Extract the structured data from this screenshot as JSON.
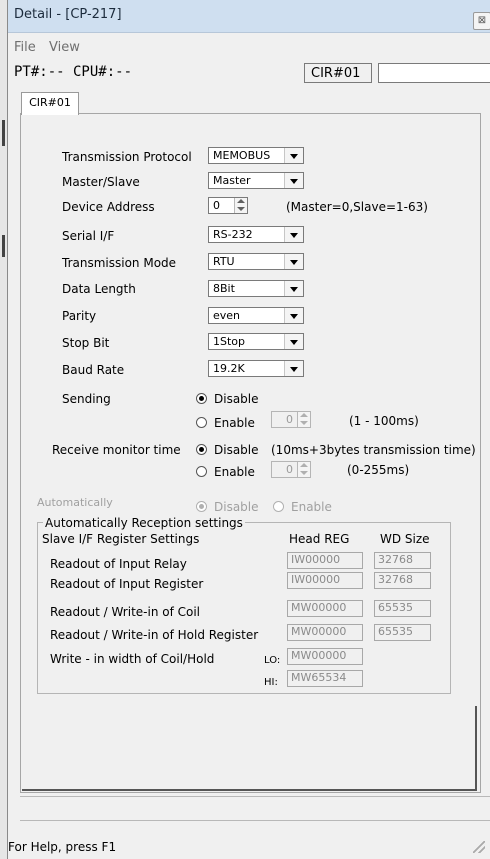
{
  "window": {
    "title": "Detail - [CP-217]",
    "close_glyph": "⊠"
  },
  "menu": {
    "file": "File",
    "view": "View"
  },
  "status_row": {
    "pt_cpu": "PT#:-- CPU#:--",
    "cir": "CIR#01",
    "empty": ""
  },
  "tab": {
    "label": "CIR#01"
  },
  "form": {
    "protocol": {
      "label": "Transmission Protocol",
      "value": "MEMOBUS"
    },
    "master_slave": {
      "label": "Master/Slave",
      "value": "Master"
    },
    "device_address": {
      "label": "Device Address",
      "value": "0",
      "hint": "(Master=0,Slave=1-63)"
    },
    "serial_if": {
      "label": "Serial I/F",
      "value": "RS-232"
    },
    "mode": {
      "label": "Transmission Mode",
      "value": "RTU"
    },
    "data_length": {
      "label": "Data Length",
      "value": "8Bit"
    },
    "parity": {
      "label": "Parity",
      "value": "even"
    },
    "stop_bit": {
      "label": "Stop Bit",
      "value": "1Stop"
    },
    "baud_rate": {
      "label": "Baud Rate",
      "value": "19.2K"
    },
    "sending": {
      "label": "Sending",
      "disable": "Disable",
      "enable": "Enable",
      "value": "0",
      "range": "(1 - 100ms)"
    },
    "receive": {
      "label": "Receive monitor time",
      "disable": "Disable",
      "enable": "Enable",
      "hint": "(10ms+3bytes transmission time)",
      "value": "0",
      "range": "(0-255ms)"
    },
    "auto": {
      "label": "Automatically",
      "disable": "Disable",
      "enable": "Enable"
    }
  },
  "reception": {
    "group_title": "Automatically Reception settings",
    "header_left": "Slave I/F Register Settings",
    "header_head": "Head REG",
    "header_size": "WD Size",
    "rows": [
      {
        "label": "Readout of Input Relay",
        "head": "IW00000",
        "size": "32768"
      },
      {
        "label": "Readout of Input Register",
        "head": "IW00000",
        "size": "32768"
      },
      {
        "label": "Readout / Write-in of Coil",
        "head": "MW00000",
        "size": "65535"
      },
      {
        "label": "Readout / Write-in of Hold Register",
        "head": "MW00000",
        "size": "65535"
      }
    ],
    "width_label": "Write - in width of Coil/Hold",
    "lo_label": "LO:",
    "lo_value": "MW00000",
    "hi_label": "HI:",
    "hi_value": "MW65534"
  },
  "status_bar": {
    "help": "For Help, press F1"
  }
}
